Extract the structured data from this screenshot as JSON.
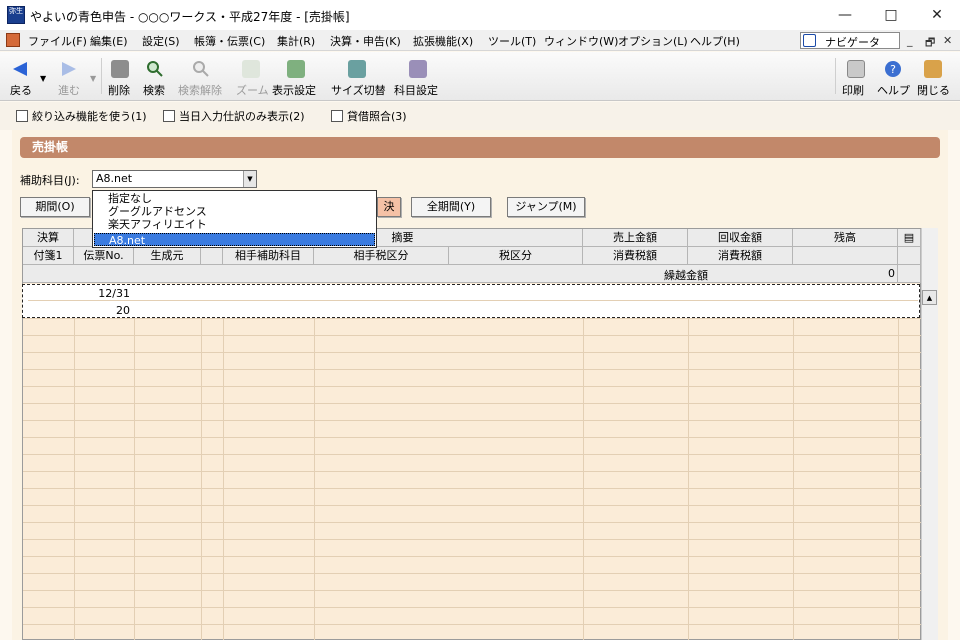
{
  "window": {
    "title": "やよいの青色申告 - ○○○ワークス・平成27年度 - [売掛帳]",
    "app_icon_text": "弥生",
    "controls": {
      "minimize": "—",
      "maximize": "□",
      "close": "✕"
    }
  },
  "menu": {
    "items": [
      "ファイル(F)",
      "編集(E)",
      "設定(S)",
      "帳簿・伝票(C)",
      "集計(R)",
      "決算・申告(K)",
      "拡張機能(X)",
      "ツール(T)",
      "ウィンドウ(W)",
      "オプション(L)",
      "ヘルプ(H)"
    ],
    "navigator": "ナビゲータ",
    "mdi": {
      "minimize": "_",
      "restore": "🗗",
      "close": "✕"
    }
  },
  "toolbar": {
    "back": "戻る",
    "forward": "進む",
    "delete": "削除",
    "search": "検索",
    "clear_search": "検索解除",
    "zoom": "ズーム",
    "display_settings": "表示設定",
    "size_switch": "サイズ切替",
    "account_settings": "科目設定",
    "print": "印刷",
    "help": "ヘルプ",
    "close": "閉じる"
  },
  "options": {
    "filter": "絞り込み機能を使う(1)",
    "today_only": "当日入力仕訳のみ表示(2)",
    "balance_check": "貸借照合(3)"
  },
  "panel": {
    "title": "売掛帳",
    "sub_account_label": "補助科目(J):",
    "sub_account_value": "A8.net",
    "dropdown_options": [
      "指定なし",
      "グーグルアドセンス",
      "楽天アフィリエイト",
      "A8.net"
    ],
    "dropdown_selected_index": 3,
    "period_button": "期間(O)",
    "settle_button": "決",
    "all_period_button": "全期間(Y)",
    "jump_button": "ジャンプ(M)"
  },
  "grid": {
    "header_row1": [
      "決算",
      "摘要",
      "売上金額",
      "回収金額",
      "残高"
    ],
    "header_row2": [
      "付箋1",
      "伝票No.",
      "生成元",
      "相手補助科目",
      "相手税区分",
      "税区分",
      "消費税額",
      "消費税額"
    ],
    "carry_label": "繰越金額",
    "carry_value": "0",
    "row1": {
      "date": "12/31",
      "voucher": "20"
    }
  }
}
